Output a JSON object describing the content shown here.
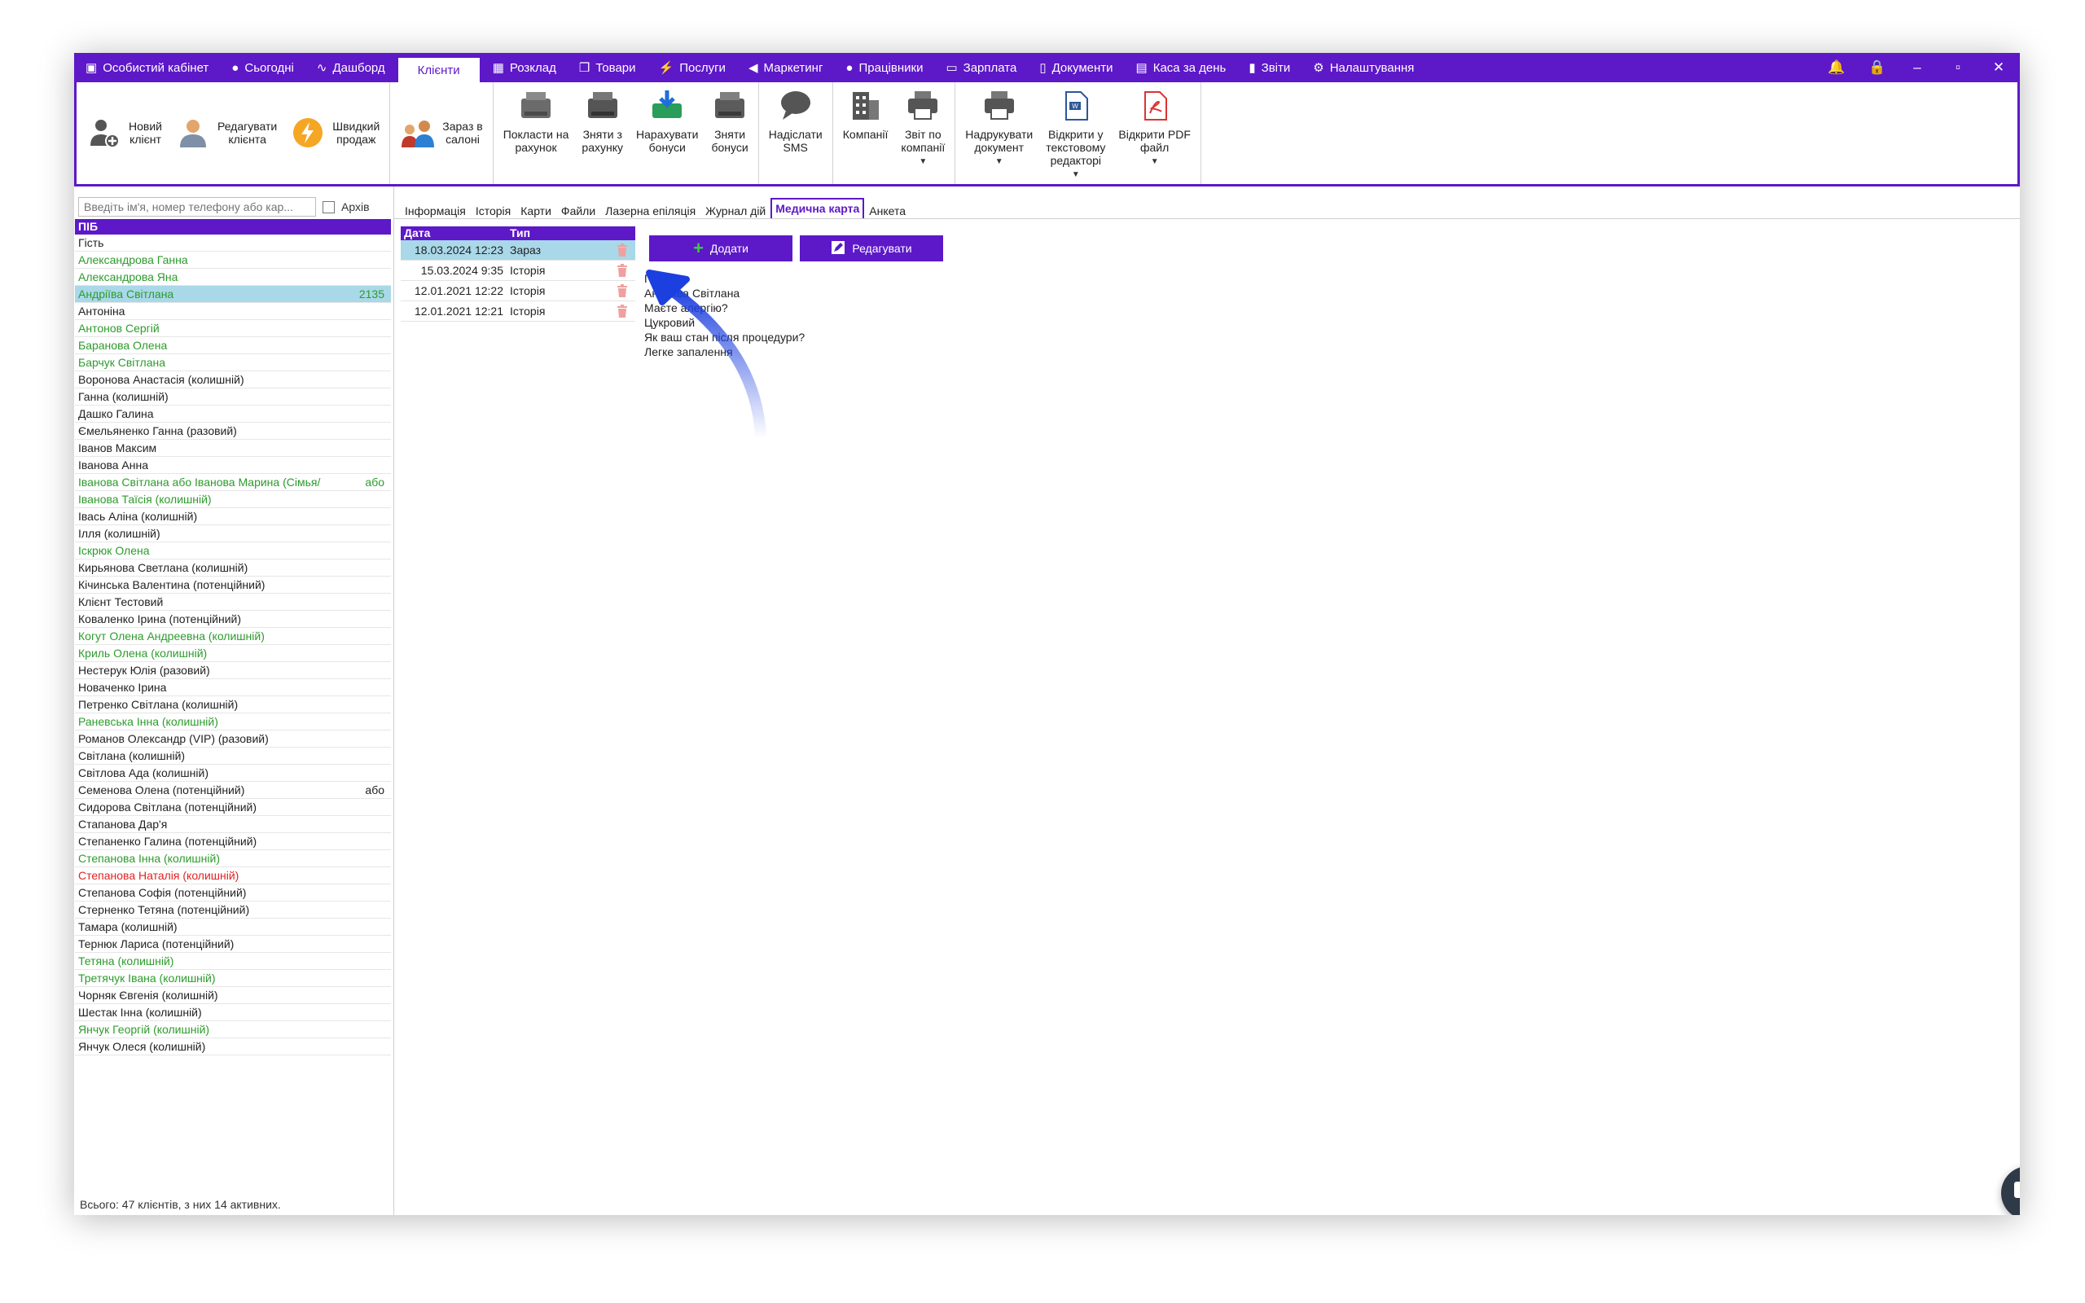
{
  "colors": {
    "accent": "#5d18c8",
    "selection": "#a9d8e8",
    "green": "#2c9c2c",
    "red": "#e32222",
    "arrow": "#1c3fe0"
  },
  "menu": [
    {
      "label": "Особистий кабінет",
      "icon": "briefcase-icon"
    },
    {
      "label": "Сьогодні",
      "icon": "clock-icon"
    },
    {
      "label": "Дашборд",
      "icon": "pulse-icon"
    },
    {
      "label": "Клієнти",
      "icon": "",
      "active": true
    },
    {
      "label": "Розклад",
      "icon": "calendar-icon"
    },
    {
      "label": "Товари",
      "icon": "box-icon"
    },
    {
      "label": "Послуги",
      "icon": "lightning-icon"
    },
    {
      "label": "Маркетинг",
      "icon": "megaphone-icon"
    },
    {
      "label": "Працівники",
      "icon": "person-icon"
    },
    {
      "label": "Зарплата",
      "icon": "money-icon"
    },
    {
      "label": "Документи",
      "icon": "document-icon"
    },
    {
      "label": "Каса за день",
      "icon": "calculator-icon"
    },
    {
      "label": "Звіти",
      "icon": "bar-chart-icon"
    },
    {
      "label": "Налаштування",
      "icon": "gear-icon"
    }
  ],
  "ribbon": {
    "new_client": "Новий\nклієнт",
    "edit_client": "Редагувати\nклієнта",
    "quick_sale": "Швидкий\nпродаж",
    "in_salon": "Зараз в\nсалоні",
    "deposit": "Покласти на\nрахунок",
    "withdraw": "Зняти з\nрахунку",
    "add_bonus": "Нарахувати\nбонуси",
    "remove_bonus": "Зняти\nбонуси",
    "send_sms": "Надіслати\nSMS",
    "companies": "Компанії",
    "company_report": "Звіт по\nкомпанії",
    "print_doc": "Надрукувати\nдокумент",
    "open_text": "Відкрити у\nтекстовому\nредакторі",
    "open_pdf": "Відкрити PDF\nфайл"
  },
  "search": {
    "placeholder": "Введіть ім'я, номер телефону або кар...",
    "archive_label": "Архів"
  },
  "clients": {
    "header": "ПІБ",
    "rows": [
      {
        "name": "Гість",
        "color": "black",
        "extra": ""
      },
      {
        "name": "Александрова Ганна",
        "color": "green",
        "extra": ""
      },
      {
        "name": "Александрова Яна",
        "color": "green",
        "extra": ""
      },
      {
        "name": "Андріїва Світлана",
        "color": "green",
        "extra": "2135",
        "selected": true
      },
      {
        "name": "Антоніна",
        "color": "black",
        "extra": ""
      },
      {
        "name": "Антонов Сергій",
        "color": "green",
        "extra": ""
      },
      {
        "name": "Баранова Олена",
        "color": "green",
        "extra": ""
      },
      {
        "name": "Барчук Світлана",
        "color": "green",
        "extra": ""
      },
      {
        "name": "Воронова Анастасія (колишній)",
        "color": "black",
        "extra": ""
      },
      {
        "name": "Ганна (колишній)",
        "color": "black",
        "extra": ""
      },
      {
        "name": "Дашко Галина",
        "color": "black",
        "extra": ""
      },
      {
        "name": "Ємельяненко Ганна (разовий)",
        "color": "black",
        "extra": ""
      },
      {
        "name": "Іванов Максим",
        "color": "black",
        "extra": ""
      },
      {
        "name": "Іванова Анна",
        "color": "black",
        "extra": ""
      },
      {
        "name": "Іванова Світлана або Іванова Марина (Сімья/",
        "color": "green",
        "extra": "або"
      },
      {
        "name": "Іванова Таїсія (колишній)",
        "color": "green",
        "extra": ""
      },
      {
        "name": "Івась Аліна (колишній)",
        "color": "black",
        "extra": ""
      },
      {
        "name": "Ілля (колишній)",
        "color": "black",
        "extra": ""
      },
      {
        "name": "Іскрюк Олена",
        "color": "green",
        "extra": ""
      },
      {
        "name": "Кирьянова Светлана (колишній)",
        "color": "black",
        "extra": ""
      },
      {
        "name": "Кічинська Валентина (потенційний)",
        "color": "black",
        "extra": ""
      },
      {
        "name": "Клієнт Тестовий",
        "color": "black",
        "extra": ""
      },
      {
        "name": "Коваленко Ірина (потенційний)",
        "color": "black",
        "extra": ""
      },
      {
        "name": "Когут Олена Андреевна (колишній)",
        "color": "green",
        "extra": ""
      },
      {
        "name": "Криль Олена (колишній)",
        "color": "green",
        "extra": ""
      },
      {
        "name": "Нестерук Юлія (разовий)",
        "color": "black",
        "extra": ""
      },
      {
        "name": "Новаченко Ірина",
        "color": "black",
        "extra": ""
      },
      {
        "name": "Петренко Світлана (колишній)",
        "color": "black",
        "extra": ""
      },
      {
        "name": "Раневська Інна (колишній)",
        "color": "green",
        "extra": ""
      },
      {
        "name": "Романов Олександр (VIP) (разовий)",
        "color": "black",
        "extra": ""
      },
      {
        "name": "Світлана (колишній)",
        "color": "black",
        "extra": ""
      },
      {
        "name": "Світлова Ада (колишній)",
        "color": "black",
        "extra": ""
      },
      {
        "name": "Семенова Олена (потенційний)",
        "color": "black",
        "extra": "або"
      },
      {
        "name": "Сидорова Світлана (потенційний)",
        "color": "black",
        "extra": ""
      },
      {
        "name": "Стапанова Дар'я",
        "color": "black",
        "extra": ""
      },
      {
        "name": "Степаненко Галина (потенційний)",
        "color": "black",
        "extra": ""
      },
      {
        "name": "Степанова Інна (колишній)",
        "color": "green",
        "extra": ""
      },
      {
        "name": "Степанова Наталія (колишній)",
        "color": "red",
        "extra": ""
      },
      {
        "name": "Степанова Софія (потенційний)",
        "color": "black",
        "extra": ""
      },
      {
        "name": "Стерненко Тетяна (потенційний)",
        "color": "black",
        "extra": ""
      },
      {
        "name": "Тамара (колишній)",
        "color": "black",
        "extra": ""
      },
      {
        "name": "Тернюк Лариса (потенційний)",
        "color": "black",
        "extra": ""
      },
      {
        "name": "Тетяна (колишній)",
        "color": "green",
        "extra": ""
      },
      {
        "name": "Третячук Івана (колишній)",
        "color": "green",
        "extra": ""
      },
      {
        "name": "Чорняк Євгенія (колишній)",
        "color": "black",
        "extra": ""
      },
      {
        "name": "Шестак Інна (колишній)",
        "color": "black",
        "extra": ""
      },
      {
        "name": "Янчук Георгій (колишній)",
        "color": "green",
        "extra": ""
      },
      {
        "name": "Янчук Олеся (колишній)",
        "color": "black",
        "extra": ""
      }
    ],
    "footer": "Всього: 47 клієнтів, з них 14 активних."
  },
  "content_tabs": [
    {
      "label": "Інформація"
    },
    {
      "label": "Історія"
    },
    {
      "label": "Карти"
    },
    {
      "label": "Файли"
    },
    {
      "label": "Лазерна епіляція"
    },
    {
      "label": "Журнал дій"
    },
    {
      "label": "Медична карта",
      "active": true
    },
    {
      "label": "Анкета"
    }
  ],
  "records": {
    "headers": {
      "date": "Дата",
      "type": "Тип"
    },
    "rows": [
      {
        "date": "18.03.2024 12:23",
        "type": "Зараз",
        "selected": true
      },
      {
        "date": "15.03.2024 9:35",
        "type": "Історія"
      },
      {
        "date": "12.01.2021 12:22",
        "type": "Історія"
      },
      {
        "date": "12.01.2021 12:21",
        "type": "Історія"
      }
    ]
  },
  "actions": {
    "add": "Додати",
    "edit": "Редагувати"
  },
  "questionnaire": [
    "П.І.Б.",
    "Андріїва Світлана",
    "Маєте алергію?",
    "Цукровий",
    "Як ваш стан після процедури?",
    "Легке запалення"
  ]
}
